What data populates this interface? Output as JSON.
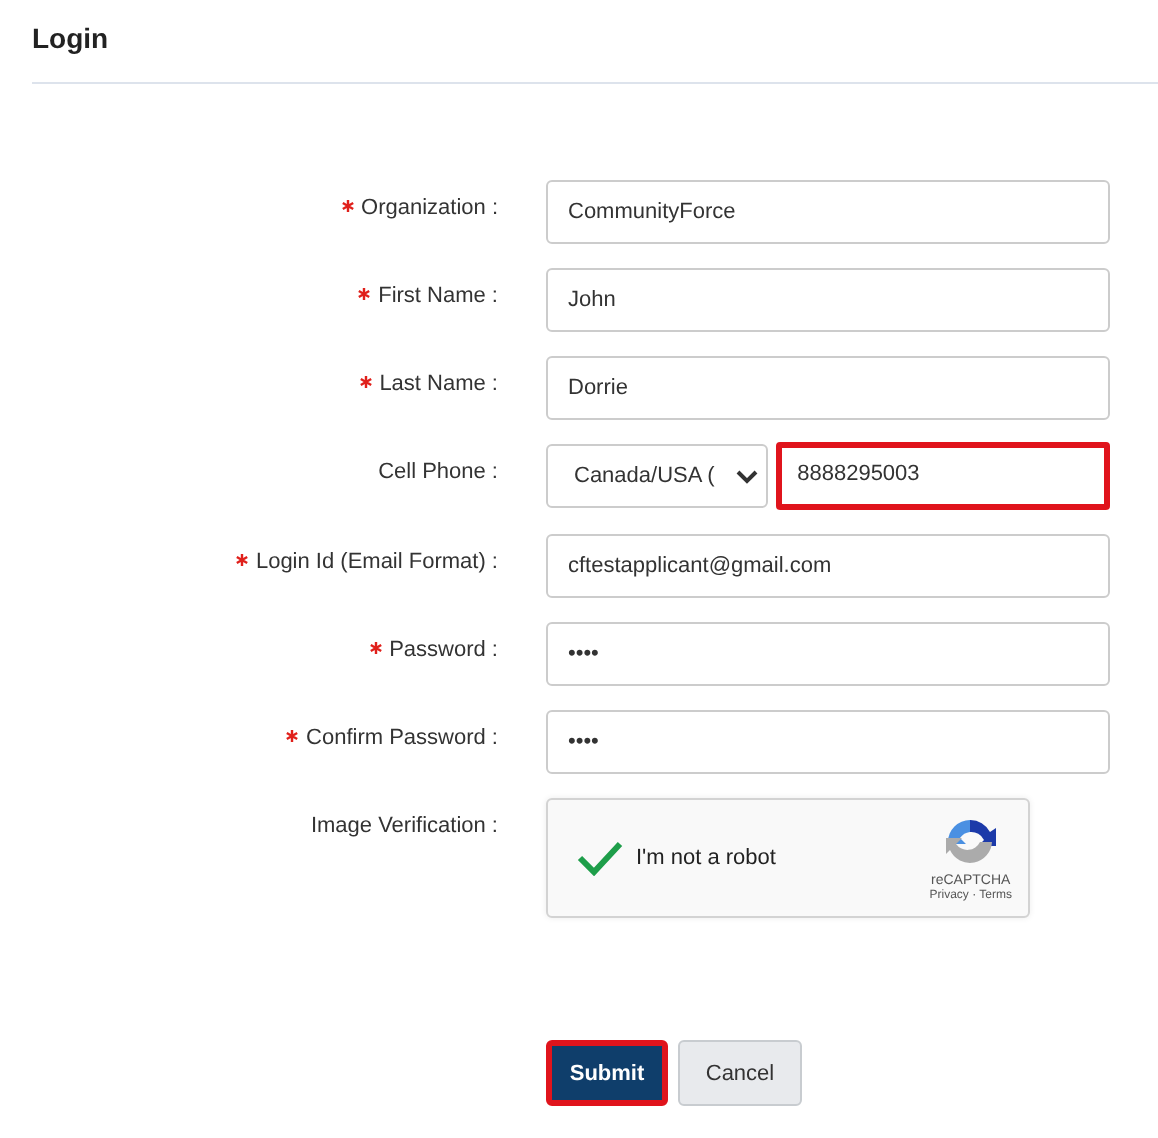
{
  "title": "Login",
  "fields": [
    {
      "label": "Organization :",
      "required": true,
      "kind": "text",
      "value": "CommunityForce",
      "highlighted": false
    },
    {
      "label": "First Name :",
      "required": true,
      "kind": "text",
      "value": "John",
      "highlighted": false
    },
    {
      "label": "Last Name :",
      "required": true,
      "kind": "text",
      "value": "Dorrie",
      "highlighted": false
    },
    {
      "label": "Cell Phone :",
      "required": false,
      "kind": "phone",
      "country": "Canada/USA (",
      "value": "8888295003",
      "highlighted": true
    },
    {
      "label": "Login Id (Email Format) :",
      "required": true,
      "kind": "text",
      "value": "cftestapplicant@gmail.com",
      "highlighted": false
    },
    {
      "label": "Password :",
      "required": true,
      "kind": "text",
      "value": "••••",
      "highlighted": false
    },
    {
      "label": "Confirm Password :",
      "required": true,
      "kind": "text",
      "value": "••••",
      "highlighted": false
    },
    {
      "label": "Image Verification :",
      "required": false,
      "kind": "captcha",
      "text": "I'm not a robot",
      "checked": true,
      "brand": "reCAPTCHA",
      "links": "Privacy · Terms"
    }
  ],
  "buttons": [
    {
      "label": "Submit",
      "kind": "primary",
      "highlighted": true
    },
    {
      "label": "Cancel",
      "kind": "secondary",
      "highlighted": false
    }
  ]
}
